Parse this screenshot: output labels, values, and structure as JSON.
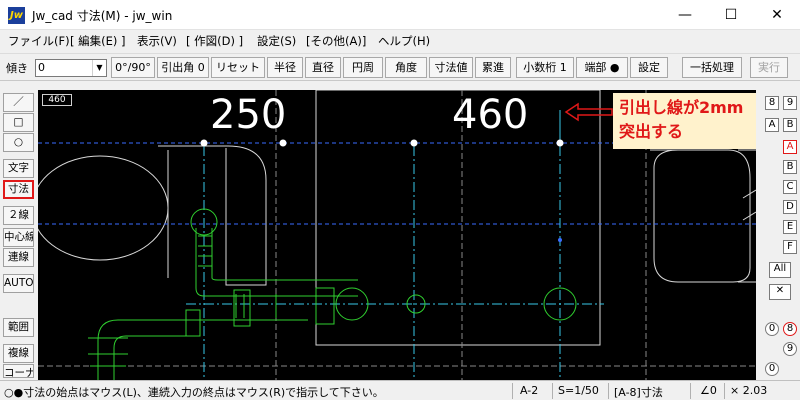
{
  "window": {
    "app_icon": "Jw",
    "title": "Jw_cad 寸法(M) - jw_win",
    "minimize": "—",
    "maximize": "☐",
    "close": "✕"
  },
  "menu": [
    "ファイル(F)",
    "[ 編集(E) ]",
    "表示(V)",
    "[ 作図(D) ]",
    "設定(S)",
    "[その他(A)]",
    "ヘルプ(H)"
  ],
  "toolbar": {
    "angle_label": "傾き",
    "angle_value": "0",
    "buttons": [
      "0°/90°",
      "引出角 0",
      "リセット",
      "半径",
      "直径",
      "円周",
      "角度",
      "寸法値",
      "累進",
      "小数桁 1",
      "端部 ●",
      "設定",
      "一括処理",
      "実行"
    ]
  },
  "left_tools": [
    "／",
    "□",
    "○",
    "文字",
    "寸法",
    "２線",
    "中心線",
    "連線",
    "AUTO",
    "範囲",
    "複線",
    "コーナー"
  ],
  "canvas": {
    "layer_indicator": "460",
    "dim_left": "250",
    "dim_right": "460",
    "callout_line1": "引出し線が2mm",
    "callout_line2": "突出する",
    "colors": {
      "dimension_line": "#3a6cff",
      "extension_line": "#38c8e8",
      "piping": "#30d030",
      "outline": "#d8d8d8",
      "callout_arrow": "#e01818"
    }
  },
  "right_tools": {
    "numbers": [
      "8",
      "9",
      "A",
      "B",
      "C",
      "D",
      "E",
      "F",
      "0",
      "8",
      "9",
      "0"
    ],
    "letters": [
      "A",
      "B",
      "C",
      "D",
      "E",
      "F"
    ],
    "all_label": "All",
    "cross": "✕"
  },
  "status": {
    "message": "○●寸法の始点はマウス(L)、連続入力の終点はマウス(R)で指示して下さい。",
    "paper": "A-2",
    "scale": "S=1/50",
    "layer": "[A-8]寸法",
    "angle": "∠0",
    "zoom": "× 2.03"
  }
}
